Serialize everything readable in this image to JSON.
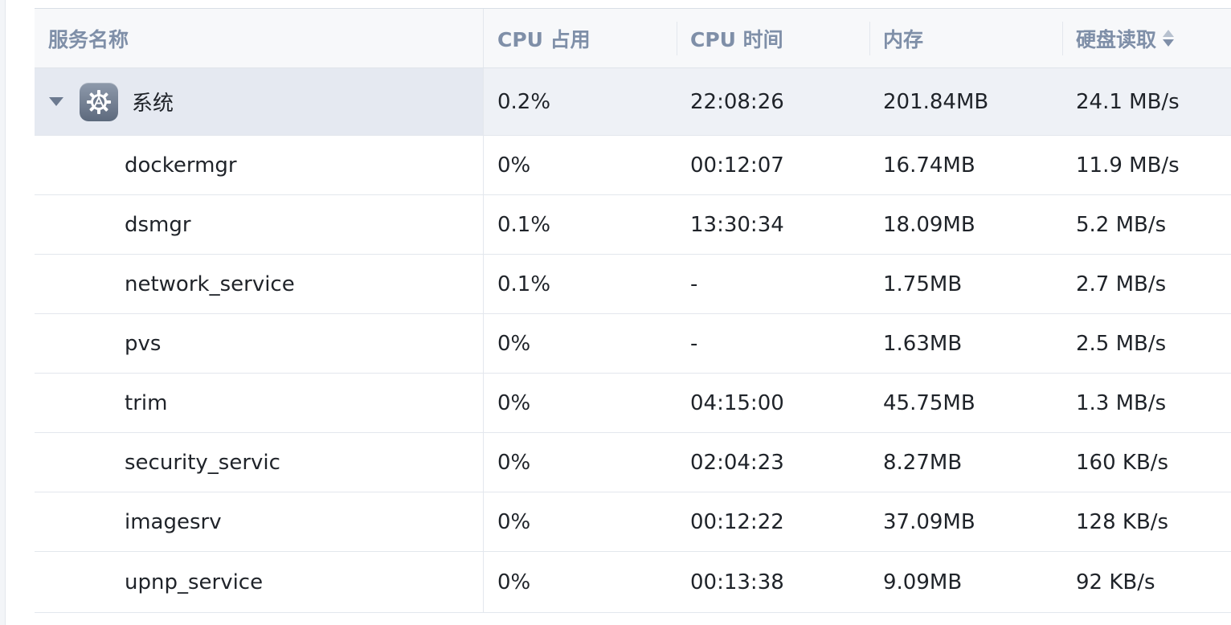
{
  "columns": {
    "name": "服务名称",
    "cpu": "CPU 占用",
    "time": "CPU 时间",
    "memory": "内存",
    "disk": "硬盘读取"
  },
  "sort": {
    "column": "disk",
    "direction": "desc"
  },
  "group": {
    "icon": "gear-icon",
    "name": "系统",
    "cpu": "0.2%",
    "time": "22:08:26",
    "memory": "201.84MB",
    "disk": "24.1 MB/s"
  },
  "rows": [
    {
      "name": "dockermgr",
      "cpu": "0%",
      "time": "00:12:07",
      "memory": "16.74MB",
      "disk": "11.9 MB/s"
    },
    {
      "name": "dsmgr",
      "cpu": "0.1%",
      "time": "13:30:34",
      "memory": "18.09MB",
      "disk": "5.2 MB/s"
    },
    {
      "name": "network_service",
      "cpu": "0.1%",
      "time": "-",
      "memory": "1.75MB",
      "disk": "2.7 MB/s"
    },
    {
      "name": "pvs",
      "cpu": "0%",
      "time": "-",
      "memory": "1.63MB",
      "disk": "2.5 MB/s"
    },
    {
      "name": "trim",
      "cpu": "0%",
      "time": "04:15:00",
      "memory": "45.75MB",
      "disk": "1.3 MB/s"
    },
    {
      "name": "security_servic",
      "cpu": "0%",
      "time": "02:04:23",
      "memory": "8.27MB",
      "disk": "160 KB/s"
    },
    {
      "name": "imagesrv",
      "cpu": "0%",
      "time": "00:12:22",
      "memory": "37.09MB",
      "disk": "128 KB/s"
    },
    {
      "name": "upnp_service",
      "cpu": "0%",
      "time": "00:13:38",
      "memory": "9.09MB",
      "disk": "92 KB/s"
    }
  ]
}
